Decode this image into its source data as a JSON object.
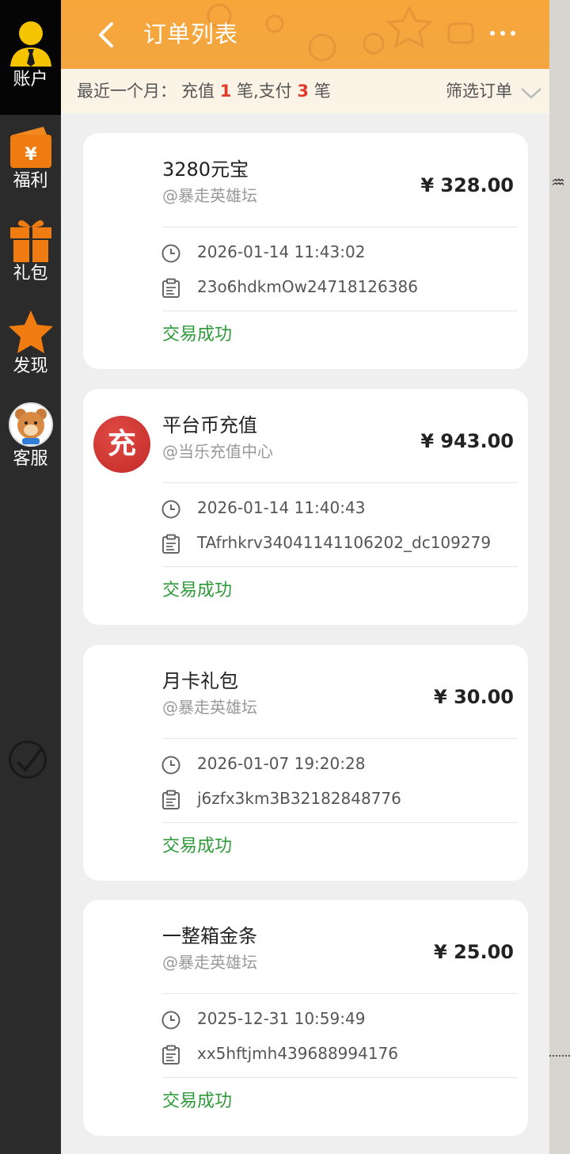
{
  "sidebar": {
    "items": [
      {
        "label": "账户",
        "icon": "account-icon"
      },
      {
        "label": "福利",
        "icon": "welfare-icon"
      },
      {
        "label": "礼包",
        "icon": "gift-icon"
      },
      {
        "label": "发现",
        "icon": "star-icon"
      },
      {
        "label": "客服",
        "icon": "support-avatar-icon"
      }
    ]
  },
  "header": {
    "title": "订单列表",
    "back_icon": "chevron-left-icon",
    "more_icon": "more-dots-icon"
  },
  "summary": {
    "prefix": "最近一个月：",
    "recharge_label": "充值",
    "recharge_count": "1",
    "recharge_unit": "笔,支付",
    "pay_count": "3",
    "pay_unit": "笔",
    "filter_label": "筛选订单"
  },
  "orders": [
    {
      "name": "3280元宝",
      "merchant": "@暴走英雄坛",
      "price": "¥ 328.00",
      "time": "2026-01-14 11:43:02",
      "order_no": "23o6hdkmOw24718126386",
      "status": "交易成功"
    },
    {
      "name": "平台币充值",
      "merchant": "@当乐充值中心",
      "price": "¥ 943.00",
      "time": "2026-01-14 11:40:43",
      "order_no": "TAfrhkrv34041141106202_dc109279",
      "status": "交易成功",
      "logo_char": "充"
    },
    {
      "name": "月卡礼包",
      "merchant": "@暴走英雄坛",
      "price": "¥ 30.00",
      "time": "2026-01-07 19:20:28",
      "order_no": "j6zfx3km3B32182848776",
      "status": "交易成功"
    },
    {
      "name": "一整箱金条",
      "merchant": "@暴走英雄坛",
      "price": "¥ 25.00",
      "time": "2025-12-31 10:59:49",
      "order_no": "xx5hftjmh439688994176",
      "status": "交易成功"
    }
  ],
  "colors": {
    "accent": "#f3a640",
    "success": "#2e9a3a",
    "count": "#e23a2a"
  }
}
